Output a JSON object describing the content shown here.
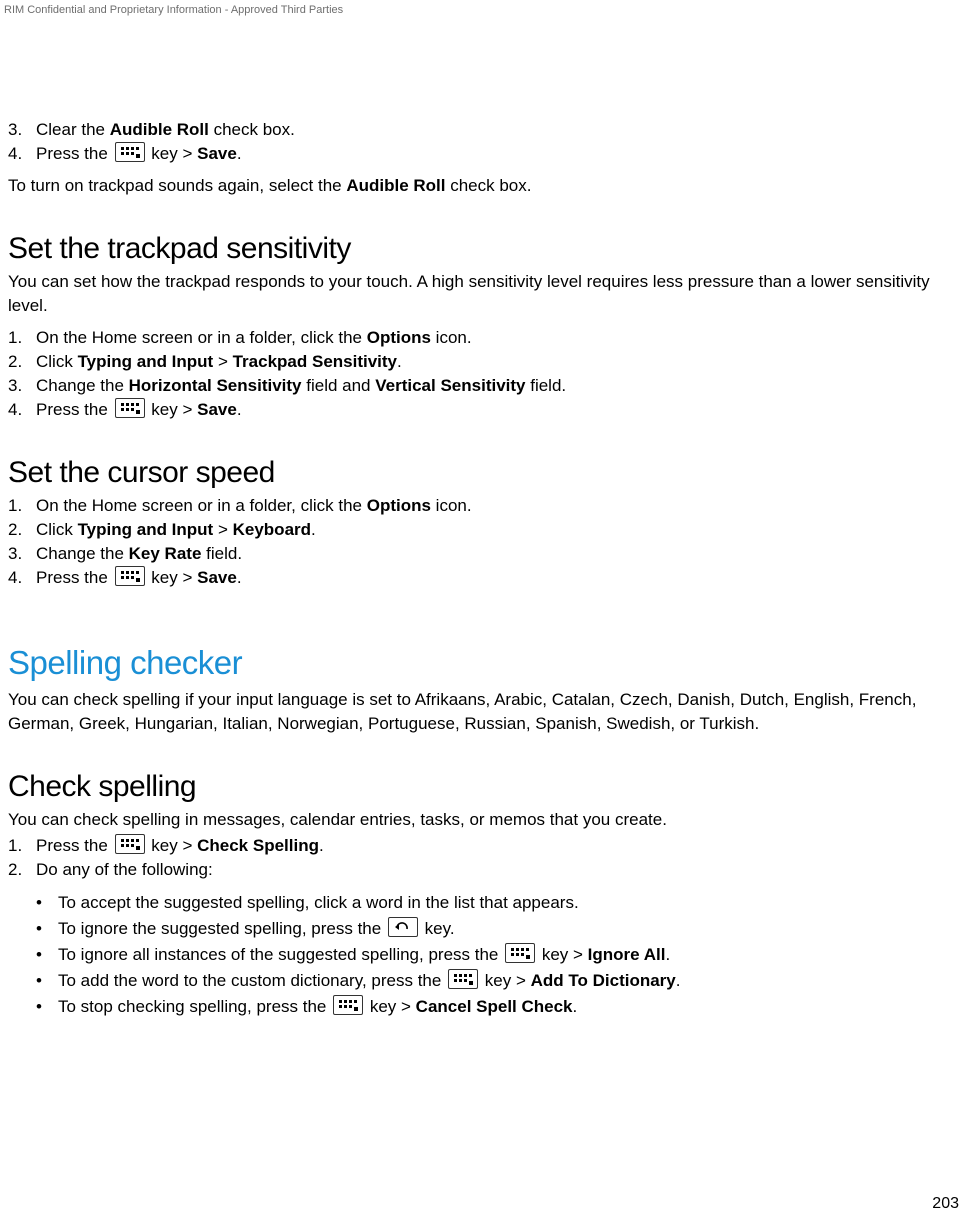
{
  "header": {
    "confidential": "RIM Confidential and Proprietary Information - Approved Third Parties"
  },
  "top_list": {
    "n3": "3.",
    "t3a": "Clear the ",
    "t3b": "Audible Roll",
    "t3c": " check box.",
    "n4": "4.",
    "t4a": "Press the ",
    "t4b": " key > ",
    "t4c": "Save",
    "t4d": "."
  },
  "audible_note_a": "To turn on trackpad sounds again, select the ",
  "audible_note_b": "Audible Roll",
  "audible_note_c": " check box.",
  "h_trackpad": "Set the trackpad sensitivity",
  "trackpad_intro": "You can set how the trackpad responds to your touch. A high sensitivity level requires less pressure than a lower sensitivity level.",
  "trackpad_steps": {
    "n1": "1.",
    "t1a": "On the Home screen or in a folder, click the ",
    "t1b": "Options",
    "t1c": " icon.",
    "n2": "2.",
    "t2a": "Click ",
    "t2b": "Typing and Input",
    "t2c": " > ",
    "t2d": "Trackpad Sensitivity",
    "t2e": ".",
    "n3": "3.",
    "t3a": "Change the ",
    "t3b": "Horizontal Sensitivity",
    "t3c": " field and ",
    "t3d": "Vertical Sensitivity",
    "t3e": " field.",
    "n4": "4.",
    "t4a": "Press the ",
    "t4b": " key > ",
    "t4c": "Save",
    "t4d": "."
  },
  "h_cursor": "Set the cursor speed",
  "cursor_steps": {
    "n1": "1.",
    "t1a": "On the Home screen or in a folder, click the ",
    "t1b": "Options",
    "t1c": " icon.",
    "n2": "2.",
    "t2a": "Click ",
    "t2b": "Typing and Input",
    "t2c": " > ",
    "t2d": "Keyboard",
    "t2e": ".",
    "n3": "3.",
    "t3a": "Change the ",
    "t3b": "Key Rate",
    "t3c": " field.",
    "n4": "4.",
    "t4a": "Press the ",
    "t4b": " key > ",
    "t4c": "Save",
    "t4d": "."
  },
  "h_spelling_section": "Spelling checker",
  "spelling_intro": "You can check spelling if your input language is set to Afrikaans, Arabic, Catalan, Czech, Danish, Dutch, English, French, German, Greek, Hungarian, Italian, Norwegian, Portuguese, Russian, Spanish, Swedish, or Turkish.",
  "h_check": "Check spelling",
  "check_intro": "You can check spelling in messages, calendar entries, tasks, or memos that you create.",
  "check_steps": {
    "n1": "1.",
    "t1a": "Press the ",
    "t1b": " key > ",
    "t1c": "Check Spelling",
    "t1d": ".",
    "n2": "2.",
    "t2": "Do any of the following:"
  },
  "check_sub": {
    "bull": "•",
    "s1": "To accept the suggested spelling, click a word in the list that appears.",
    "s2a": "To ignore the suggested spelling, press the ",
    "s2b": " key.",
    "s3a": "To ignore all instances of the suggested spelling, press the ",
    "s3b": " key > ",
    "s3c": "Ignore All",
    "s3d": ".",
    "s4a": "To add the word to the custom dictionary, press the ",
    "s4b": " key > ",
    "s4c": "Add To Dictionary",
    "s4d": ".",
    "s5a": "To stop checking spelling, press the ",
    "s5b": " key > ",
    "s5c": "Cancel Spell Check",
    "s5d": "."
  },
  "page_number": "203"
}
